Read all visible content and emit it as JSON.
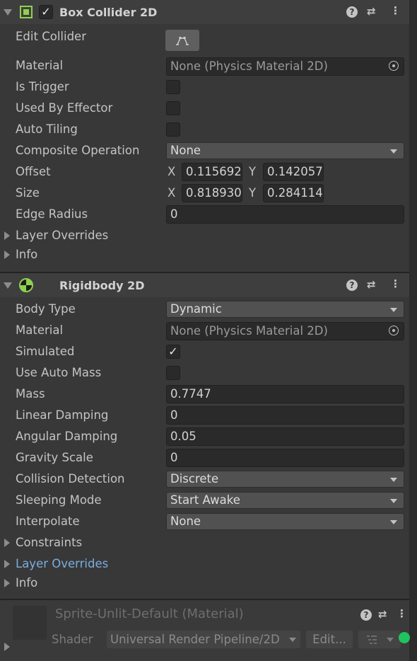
{
  "box_collider": {
    "title": "Box Collider 2D",
    "enabled_check": "✓",
    "help": "?",
    "presets": "⇄",
    "menu": "⋮",
    "rows": {
      "edit_collider": "Edit Collider",
      "material": "Material",
      "material_value": "None (Physics Material 2D)",
      "is_trigger": "Is Trigger",
      "used_by_effector": "Used By Effector",
      "auto_tiling": "Auto Tiling",
      "composite_operation": "Composite Operation",
      "composite_operation_value": "None",
      "offset": "Offset",
      "offset_x": "0.115692",
      "offset_y": "0.142057",
      "size": "Size",
      "size_x": "0.818930",
      "size_y": "0.284114",
      "edge_radius": "Edge Radius",
      "edge_radius_value": "0",
      "layer_overrides": "Layer Overrides",
      "info": "Info",
      "x": "X",
      "y": "Y"
    }
  },
  "rigidbody": {
    "title": "Rigidbody 2D",
    "help": "?",
    "presets": "⇄",
    "menu": "⋮",
    "rows": {
      "body_type": "Body Type",
      "body_type_value": "Dynamic",
      "material": "Material",
      "material_value": "None (Physics Material 2D)",
      "simulated": "Simulated",
      "simulated_check": "✓",
      "use_auto_mass": "Use Auto Mass",
      "mass": "Mass",
      "mass_value": "0.7747",
      "linear_damping": "Linear Damping",
      "linear_damping_value": "0",
      "angular_damping": "Angular Damping",
      "angular_damping_value": "0.05",
      "gravity_scale": "Gravity Scale",
      "gravity_scale_value": "0",
      "collision_detection": "Collision Detection",
      "collision_detection_value": "Discrete",
      "sleeping_mode": "Sleeping Mode",
      "sleeping_mode_value": "Start Awake",
      "interpolate": "Interpolate",
      "interpolate_value": "None",
      "constraints": "Constraints",
      "layer_overrides": "Layer Overrides",
      "info": "Info"
    }
  },
  "material_footer": {
    "title": "Sprite-Unlit-Default (Material)",
    "shader_label": "Shader",
    "shader_value": "Universal Render Pipeline/2D",
    "edit_button": "Edit...",
    "help": "?",
    "presets": "⇄",
    "menu": "⋮"
  },
  "colors": {
    "accent_green": "#8fd14f",
    "link_blue": "#7aaede",
    "status_green": "#1fc45e"
  }
}
